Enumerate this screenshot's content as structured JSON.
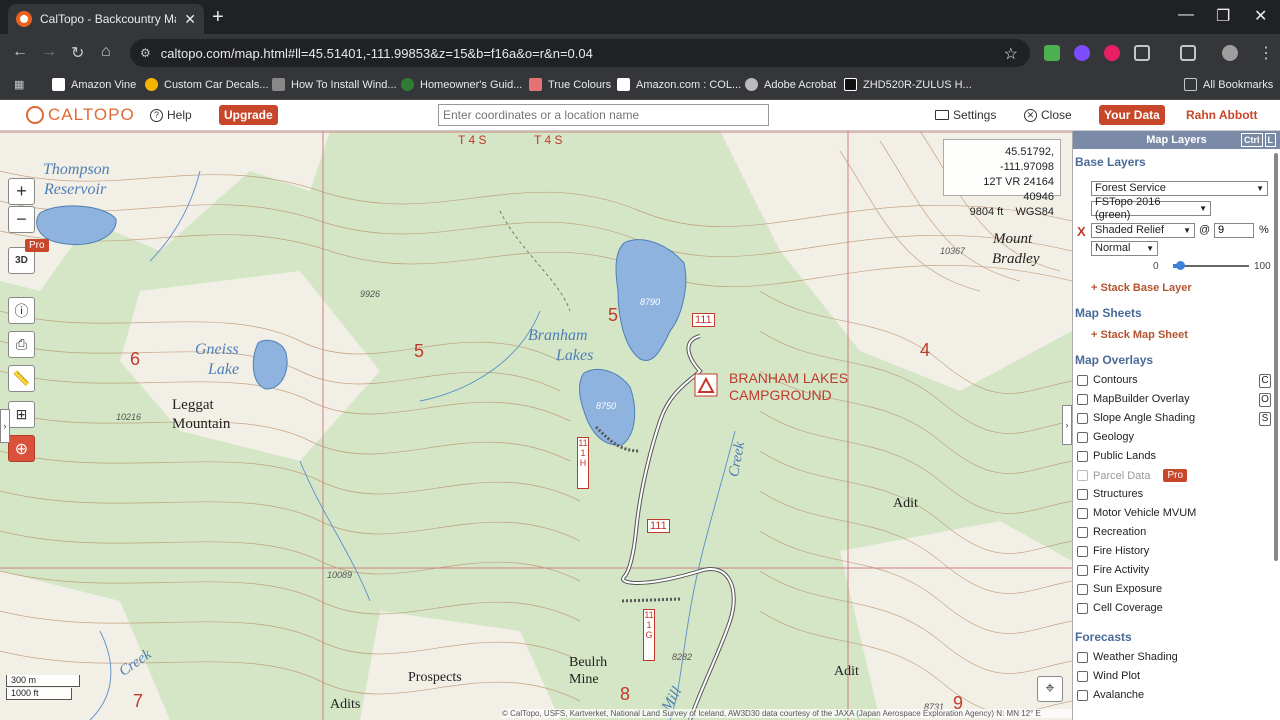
{
  "browser": {
    "tab_title": "CalTopo - Backcountry Mapping",
    "url": "caltopo.com/map.html#ll=45.51401,-111.99853&z=15&b=f16a&o=r&n=0.04",
    "bookmarks": [
      "Amazon Vine",
      "Custom Car Decals...",
      "How To Install Wind...",
      "Homeowner's Guid...",
      "True Colours",
      "Amazon.com : COL...",
      "Adobe Acrobat",
      "ZHD520R-ZULUS H..."
    ],
    "all_bookmarks": "All Bookmarks"
  },
  "header": {
    "logo": "CALTOPO",
    "help": "Help",
    "upgrade": "Upgrade",
    "search_placeholder": "Enter coordinates or a location name",
    "settings": "Settings",
    "close": "Close",
    "your_data": "Your Data",
    "user": "Rahn Abbott"
  },
  "map": {
    "coords": {
      "latlon": "45.51792, -111.97098",
      "utm": "12T VR 24164 40946",
      "elev": "9804 ft",
      "datum": "WGS84"
    },
    "labels": {
      "thompson": "Thompson",
      "reservoir": "Reservoir",
      "gneiss": "Gneiss",
      "lake": "Lake",
      "leggat": "Leggat",
      "mountain": "Mountain",
      "branham": "Branham",
      "lakes": "Lakes",
      "campground1": "BRANHAM LAKES",
      "campground2": "CAMPGROUND",
      "mount": "Mount",
      "bradley": "Bradley",
      "creek1": "Creek",
      "creek2": "Creek",
      "adit1": "Adit",
      "adit2": "Adit",
      "adits": "Adits",
      "prospects": "Prospects",
      "beulrh": "Beulrh",
      "mine": "Mine",
      "mill": "Mill",
      "t4s1": "T 4 S",
      "t4s2": "T 4 S"
    },
    "sections": [
      "6",
      "5",
      "5",
      "4",
      "7",
      "8",
      "9"
    ],
    "elevations": {
      "e9926": "9926",
      "e10216": "10216",
      "e10089": "10089",
      "e10367": "10367",
      "e8282": "8282",
      "e8731": "8731",
      "e8790": "8790",
      "e8750": "8750"
    },
    "road_shields": [
      "111",
      "111",
      "111H",
      "111G"
    ],
    "pro_badge": "Pro",
    "scale_m": "300 m",
    "scale_ft": "1000 ft",
    "attribution": "© CalTopo, USFS, Kartverket, National Land Survey of Iceland, AW3D30 data courtesy of the JAXA (Japan Aerospace Exploration Agency)  N: MN 12° E"
  },
  "panel": {
    "title": "Map Layers",
    "keys": [
      "Ctrl",
      "L"
    ],
    "base_layers": "Base Layers",
    "base_select": "Forest Service",
    "topo_select": "FSTopo 2016 (green)",
    "relief_select": "Shaded Relief",
    "at": "@",
    "opacity": "9",
    "percent": "%",
    "blend_select": "Normal",
    "slider_min": "0",
    "slider_max": "100",
    "slider_value": 9,
    "stack_base": "+ Stack Base Layer",
    "map_sheets": "Map Sheets",
    "stack_sheet": "+ Stack Map Sheet",
    "map_overlays": "Map Overlays",
    "overlays": [
      {
        "label": "Contours",
        "key": "C"
      },
      {
        "label": "MapBuilder Overlay",
        "key": "O"
      },
      {
        "label": "Slope Angle Shading",
        "key": "S"
      },
      {
        "label": "Geology",
        "key": ""
      },
      {
        "label": "Public Lands",
        "key": ""
      },
      {
        "label": "Parcel Data",
        "key": ""
      },
      {
        "label": "Structures",
        "key": ""
      },
      {
        "label": "Motor Vehicle MVUM",
        "key": ""
      },
      {
        "label": "Recreation",
        "key": ""
      },
      {
        "label": "Fire History",
        "key": ""
      },
      {
        "label": "Fire Activity",
        "key": ""
      },
      {
        "label": "Sun Exposure",
        "key": ""
      },
      {
        "label": "Cell Coverage",
        "key": ""
      }
    ],
    "pro": "Pro",
    "forecasts": "Forecasts",
    "forecast_items": [
      "Weather Shading",
      "Wind Plot",
      "Avalanche"
    ]
  },
  "colors": {
    "accent": "#c8462a",
    "panel_header": "#7b8aa6",
    "section_head": "#4a6a9a",
    "map_bg": "#f1efe6",
    "forest": "#cfe3c2",
    "water": "#8fb3df"
  }
}
